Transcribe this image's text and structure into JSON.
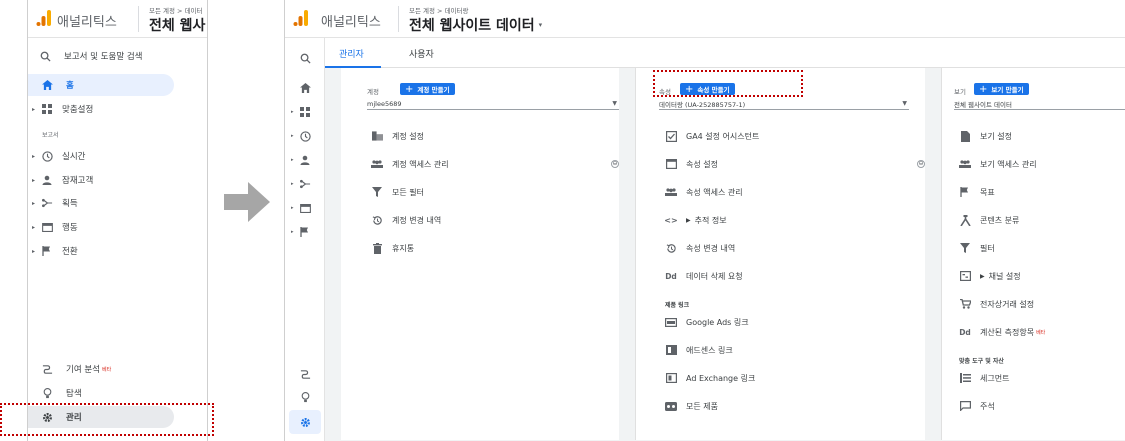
{
  "left": {
    "brand": "애널리틱스",
    "breadcrumb": "모든 계정 > 데이터",
    "title": "전체 웹사",
    "search_label": "보고서 및 도움말 검색",
    "nav": {
      "home": "홈",
      "customization": "맞춤설정",
      "reports_section": "보고서",
      "realtime": "실시간",
      "audience": "잠재고객",
      "acquisition": "획득",
      "behavior": "행동",
      "conversions": "전환"
    },
    "bottom": {
      "attribution": "기여 분석",
      "attribution_badge": "베타",
      "discover": "탐색",
      "admin": "관리"
    }
  },
  "right": {
    "brand": "애널리틱스",
    "breadcrumb": "모든 계정 > 데이터랑",
    "title": "전체 웹사이트 데이터",
    "tabs": [
      "관리자",
      "사용자"
    ],
    "account": {
      "label": "계정",
      "create_button": "계정 만들기",
      "selected": "mjlee5689",
      "items": [
        "계정 설정",
        "계정 액세스 관리",
        "모든 필터",
        "계정 변경 내역",
        "휴지통"
      ]
    },
    "property": {
      "label": "속성",
      "create_button": "속성 만들기",
      "selected": "데이터랑 (UA-252885757-1)",
      "items": [
        "GA4 설정 어시스턴트",
        "속성 설정",
        "속성 액세스 관리",
        "추적 정보",
        "속성 변경 내역",
        "데이터 삭제 요청"
      ],
      "links_section": "제품 링크",
      "links": [
        "Google Ads 링크",
        "애드센스 링크",
        "Ad Exchange 링크",
        "모든 제품"
      ]
    },
    "view": {
      "label": "보기",
      "create_button": "보기 만들기",
      "selected": "전체 웹사이트 데이터",
      "items": [
        "보기 설정",
        "보기 액세스 관리",
        "목표",
        "콘텐츠 분류",
        "필터",
        "채널 설정",
        "전자상거래 설정",
        "계산된 측정항목"
      ],
      "calc_badge": "베타",
      "tools_section": "맞춤 도구 및 자산",
      "tools": [
        "세그먼트",
        "주석"
      ]
    }
  },
  "colors": {
    "accent": "#1a73e8",
    "logo_orange": "#f9ab00",
    "logo_dark": "#e37400",
    "highlight": "#c00000",
    "active_nav_bg": "#e8f0fe"
  },
  "icons": {
    "arrow": "right-arrow",
    "logo": "analytics-bars"
  }
}
